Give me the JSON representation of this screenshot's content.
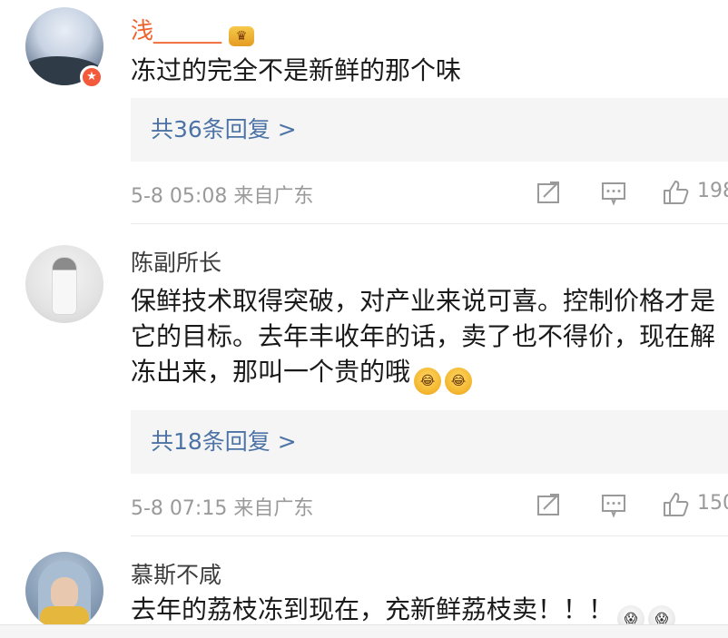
{
  "comments": [
    {
      "author": "浅______",
      "text": "冻过的完全不是新鲜的那个味",
      "emoji": [],
      "replies": "共36条回复 >",
      "meta": "5-8 05:08 来自广东",
      "likes": "198"
    },
    {
      "author": "陈副所长",
      "text": "保鲜技术取得突破，对产业来说可喜。控制价格才是它的目标。去年丰收年的话，卖了也不得价，现在解冻出来，那叫一个贵的哦",
      "emoji": [
        "laugh-cry-emoji",
        "laugh-cry-emoji"
      ],
      "replies": "共18条回复 >",
      "meta": "5-8 07:15 来自广东",
      "likes": "150"
    },
    {
      "author": "慕斯不咸",
      "text": "去年的荔枝冻到现在，充新鲜荔枝卖！！！",
      "emoji": [
        "shocked-emoji",
        "shocked-emoji"
      ]
    }
  ],
  "colors": {
    "link": "#4d73a6",
    "meta": "#9a9a9a",
    "vip_name": "#f0612c",
    "reply_bg": "#f5f5f5"
  },
  "icons": [
    "repost-icon",
    "comment-icon",
    "like-icon",
    "crown-icon",
    "vip-badge-icon"
  ]
}
